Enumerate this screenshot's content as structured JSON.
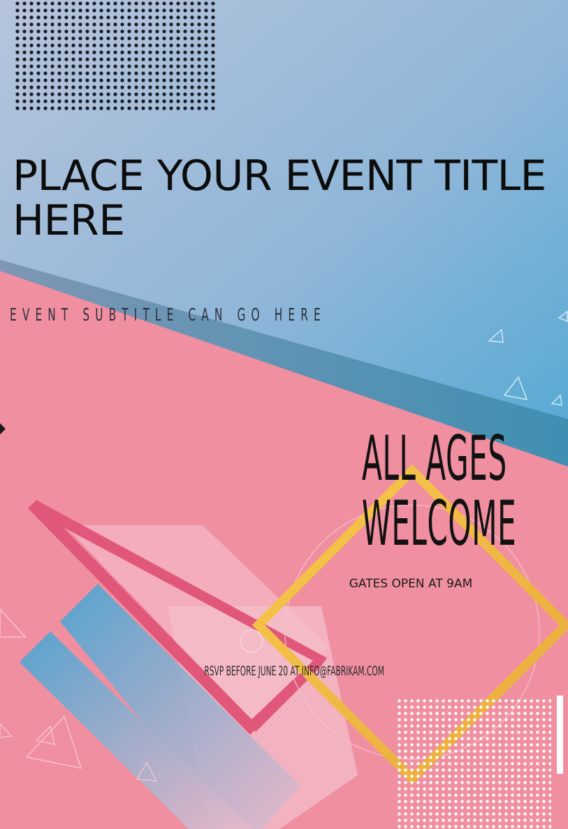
{
  "event": {
    "title": "PLACE YOUR EVENT TITLE HERE",
    "subtitle": "EVENT SUBTITLE CAN GO HERE",
    "headline_line1": "ALL AGES",
    "headline_line2": "WELCOME",
    "gates": "GATES OPEN AT 9AM",
    "rsvp": "RSVP BEFORE JUNE 20 AT INFO@FABRIKAM.COM"
  },
  "colors": {
    "sky_top": "#b3c3dc",
    "sky_bottom": "#5aaed4",
    "pink": "#f08fa0",
    "stripe_blue": "#5f95b5",
    "gold": "#f5be4a",
    "magenta": "#e0577a",
    "text_dark": "#0c0c0c"
  }
}
